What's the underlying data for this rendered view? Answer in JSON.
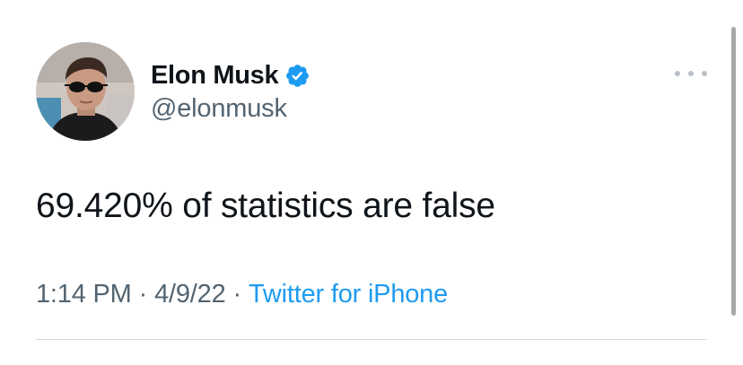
{
  "tweet": {
    "author": {
      "display_name": "Elon Musk",
      "handle": "@elonmusk",
      "verified": true
    },
    "text": "69.420% of statistics are false",
    "time": "1:14 PM",
    "date": "4/9/22",
    "source": "Twitter for iPhone",
    "separator": "·"
  },
  "icons": {
    "verified": "verified-badge-icon",
    "more": "more-options-icon"
  },
  "colors": {
    "text": "#0f1419",
    "secondary": "#536471",
    "link": "#1d9bf0",
    "verified_badge": "#1d9bf0"
  }
}
